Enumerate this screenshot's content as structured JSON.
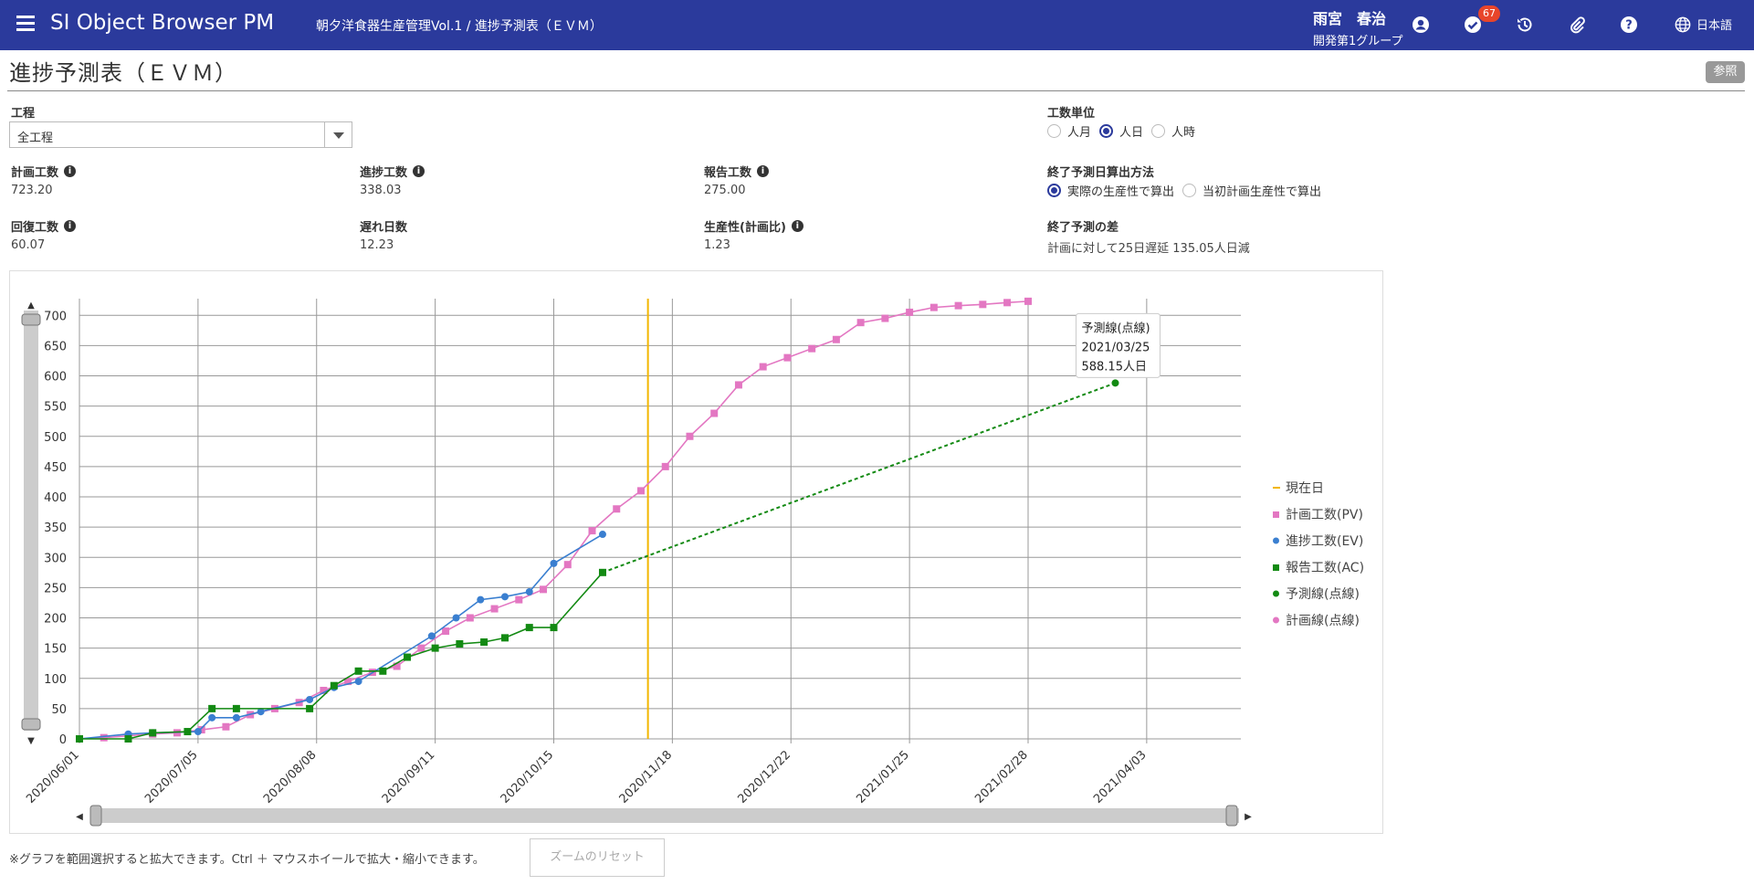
{
  "header": {
    "app_title": "SI Object Browser PM",
    "breadcrumb": "朝夕洋食器生産管理Vol.1 / 進捗予測表（ＥＶＭ）",
    "user_name": "雨宮　春治",
    "user_group": "開発第1グループ",
    "notification_count": "67",
    "language": "日本語",
    "icons": [
      "menu-icon",
      "account-icon",
      "check-circle-icon",
      "history-icon",
      "attachment-icon",
      "help-icon",
      "globe-icon"
    ],
    "color": "#2b3a9c"
  },
  "page": {
    "title": "進捗予測表（ＥＶＭ）",
    "ref_button": "参照"
  },
  "form": {
    "process_label": "工程",
    "process_value": "全工程",
    "unit_label": "工数単位",
    "unit_options": [
      {
        "label": "人月",
        "selected": false
      },
      {
        "label": "人日",
        "selected": true
      },
      {
        "label": "人時",
        "selected": false
      }
    ],
    "method_label": "終了予測日算出方法",
    "method_options": [
      {
        "label": "実際の生産性で算出",
        "selected": true
      },
      {
        "label": "当初計画生産性で算出",
        "selected": false
      }
    ]
  },
  "stats": {
    "planned_label": "計画工数",
    "planned_value": "723.20",
    "progress_label": "進捗工数",
    "progress_value": "338.03",
    "reported_label": "報告工数",
    "reported_value": "275.00",
    "recovery_label": "回復工数",
    "recovery_value": "60.07",
    "delay_label": "遅れ日数",
    "delay_value": "12.23",
    "productivity_label": "生産性(計画比)",
    "productivity_value": "1.23",
    "diff_label": "終了予測の差",
    "diff_value": "計画に対して25日遅延 135.05人日減"
  },
  "footer": {
    "note": "※グラフを範囲選択すると拡大できます。Ctrl ＋ マウスホイールで拡大・縮小できます。",
    "reset_button": "ズームのリセット"
  },
  "chart_data": {
    "type": "line",
    "xlabel": "",
    "ylabel": "",
    "x_axis_type": "date",
    "x_ticks": [
      "2020/06/01",
      "2020/07/05",
      "2020/08/08",
      "2020/09/11",
      "2020/10/15",
      "2020/11/18",
      "2020/12/22",
      "2021/01/25",
      "2021/02/28",
      "2021/04/03"
    ],
    "xlim": [
      "2020/06/01",
      "2021/04/30"
    ],
    "ylim": [
      0,
      720
    ],
    "y_ticks": [
      0,
      50,
      100,
      150,
      200,
      250,
      300,
      350,
      400,
      450,
      500,
      550,
      600,
      650,
      700
    ],
    "grid": true,
    "legend_position": "right",
    "current_date": "2020/11/11",
    "series": [
      {
        "name": "計画工数(PV)",
        "color": "#e377c2",
        "marker": "square",
        "points": [
          [
            "2020/06/01",
            0
          ],
          [
            "2020/06/08",
            2
          ],
          [
            "2020/06/15",
            5
          ],
          [
            "2020/06/22",
            8
          ],
          [
            "2020/06/29",
            10
          ],
          [
            "2020/07/06",
            15
          ],
          [
            "2020/07/13",
            20
          ],
          [
            "2020/07/20",
            40
          ],
          [
            "2020/07/27",
            50
          ],
          [
            "2020/08/03",
            60
          ],
          [
            "2020/08/10",
            80
          ],
          [
            "2020/08/17",
            95
          ],
          [
            "2020/08/24",
            110
          ],
          [
            "2020/08/31",
            120
          ],
          [
            "2020/09/07",
            150
          ],
          [
            "2020/09/14",
            178
          ],
          [
            "2020/09/21",
            200
          ],
          [
            "2020/09/28",
            215
          ],
          [
            "2020/10/05",
            230
          ],
          [
            "2020/10/12",
            247
          ],
          [
            "2020/10/19",
            288
          ],
          [
            "2020/10/26",
            344
          ],
          [
            "2020/11/02",
            380
          ],
          [
            "2020/11/09",
            410
          ],
          [
            "2020/11/16",
            450
          ],
          [
            "2020/11/23",
            500
          ],
          [
            "2020/11/30",
            538
          ],
          [
            "2020/12/07",
            585
          ],
          [
            "2020/12/14",
            615
          ],
          [
            "2020/12/21",
            630
          ],
          [
            "2020/12/28",
            645
          ],
          [
            "2021/01/04",
            660
          ],
          [
            "2021/01/11",
            688
          ],
          [
            "2021/01/18",
            695
          ],
          [
            "2021/01/25",
            705
          ],
          [
            "2021/02/01",
            713
          ],
          [
            "2021/02/08",
            716
          ],
          [
            "2021/02/15",
            718
          ],
          [
            "2021/02/22",
            721
          ],
          [
            "2021/02/28",
            723.2
          ]
        ]
      },
      {
        "name": "進捗工数(EV)",
        "color": "#3a7fd0",
        "marker": "circle",
        "points": [
          [
            "2020/06/01",
            0
          ],
          [
            "2020/06/15",
            8
          ],
          [
            "2020/06/22",
            10
          ],
          [
            "2020/07/05",
            12
          ],
          [
            "2020/07/09",
            35
          ],
          [
            "2020/07/16",
            35
          ],
          [
            "2020/07/23",
            45
          ],
          [
            "2020/08/06",
            65
          ],
          [
            "2020/08/13",
            85
          ],
          [
            "2020/08/20",
            95
          ],
          [
            "2020/09/10",
            170
          ],
          [
            "2020/09/17",
            200
          ],
          [
            "2020/09/24",
            230
          ],
          [
            "2020/10/01",
            235
          ],
          [
            "2020/10/08",
            243
          ],
          [
            "2020/10/15",
            290
          ],
          [
            "2020/10/29",
            338.03
          ]
        ]
      },
      {
        "name": "報告工数(AC)",
        "color": "#138a13",
        "marker": "square",
        "points": [
          [
            "2020/06/01",
            0
          ],
          [
            "2020/06/15",
            0
          ],
          [
            "2020/06/22",
            10
          ],
          [
            "2020/07/02",
            12
          ],
          [
            "2020/07/09",
            50
          ],
          [
            "2020/07/16",
            50
          ],
          [
            "2020/08/06",
            50
          ],
          [
            "2020/08/13",
            88
          ],
          [
            "2020/08/20",
            112
          ],
          [
            "2020/08/27",
            112
          ],
          [
            "2020/09/03",
            135
          ],
          [
            "2020/09/11",
            150
          ],
          [
            "2020/09/18",
            157
          ],
          [
            "2020/09/25",
            160
          ],
          [
            "2020/10/01",
            167
          ],
          [
            "2020/10/08",
            184
          ],
          [
            "2020/10/15",
            184
          ],
          [
            "2020/10/29",
            275
          ]
        ]
      },
      {
        "name": "予測線(点線)",
        "color": "#138a13",
        "marker": "circle",
        "dashed": true,
        "points": [
          [
            "2020/10/29",
            275
          ],
          [
            "2021/03/25",
            588.15
          ]
        ]
      },
      {
        "name": "計画線(点線)",
        "color": "#e377c2",
        "marker": "circle",
        "dashed": true,
        "points": []
      }
    ],
    "legend": [
      "現在日",
      "計画工数(PV)",
      "進捗工数(EV)",
      "報告工数(AC)",
      "予測線(点線)",
      "計画線(点線)"
    ],
    "current_date_color": "#f2b600",
    "tooltip": {
      "title": "予測線(点線)",
      "date": "2021/03/25",
      "value": "588.15人日"
    }
  }
}
